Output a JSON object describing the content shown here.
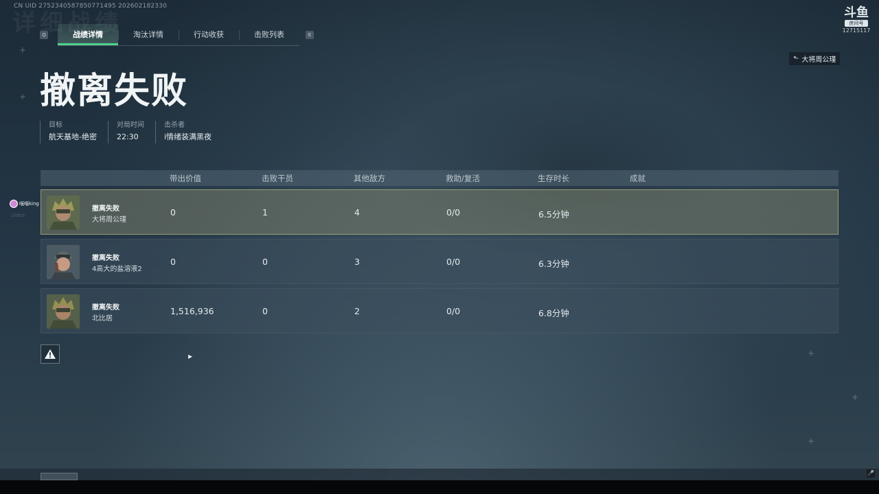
{
  "overlay": {
    "uid_text": "CN UID 2752340587850771495 202602182330",
    "bg_title": "详细战绩",
    "brand_logo": "斗鱼",
    "brand_sub": "房间号",
    "room_number": "12715117"
  },
  "key_hints": {
    "left": "Q",
    "right": "E"
  },
  "tabs": [
    {
      "label": "战绩详情",
      "active": true
    },
    {
      "label": "淘汰详情",
      "active": false
    },
    {
      "label": "行动收获",
      "active": false
    },
    {
      "label": "击败列表",
      "active": false
    }
  ],
  "killer_badge": {
    "icon": "back-arrow-icon",
    "label": "大将周公瑾"
  },
  "result_title": "撤离失败",
  "info": {
    "target_label": "目标",
    "target_value": "航天基地-绝密",
    "time_label": "对局时间",
    "time_value": "22:30",
    "killer_label": "击杀者",
    "killer_value": "i情绪装满黑夜"
  },
  "table": {
    "headers": [
      "带出价值",
      "击败干员",
      "其他敌方",
      "救助/复活",
      "生存时长",
      "成就"
    ],
    "rows": [
      {
        "status": "撤离失败",
        "player": "大将周公瑾",
        "value": "0",
        "kills": "1",
        "others": "4",
        "assist": "0/0",
        "survive": "6.5分钟",
        "highlight": true
      },
      {
        "status": "撤离失败",
        "player": "4高大的盐溶液2",
        "value": "0",
        "kills": "0",
        "others": "3",
        "assist": "0/0",
        "survive": "6.3分钟",
        "highlight": false
      },
      {
        "status": "撤离失败",
        "player": "北比居",
        "value": "1,516,936",
        "kills": "0",
        "others": "2",
        "assist": "0/0",
        "survive": "6.8分钟",
        "highlight": false
      }
    ]
  },
  "viewer": {
    "name": "喵喵king",
    "faded": "Uidea"
  },
  "colors": {
    "accent": "#4fd18c",
    "highlight_border": "#d2cd96"
  }
}
